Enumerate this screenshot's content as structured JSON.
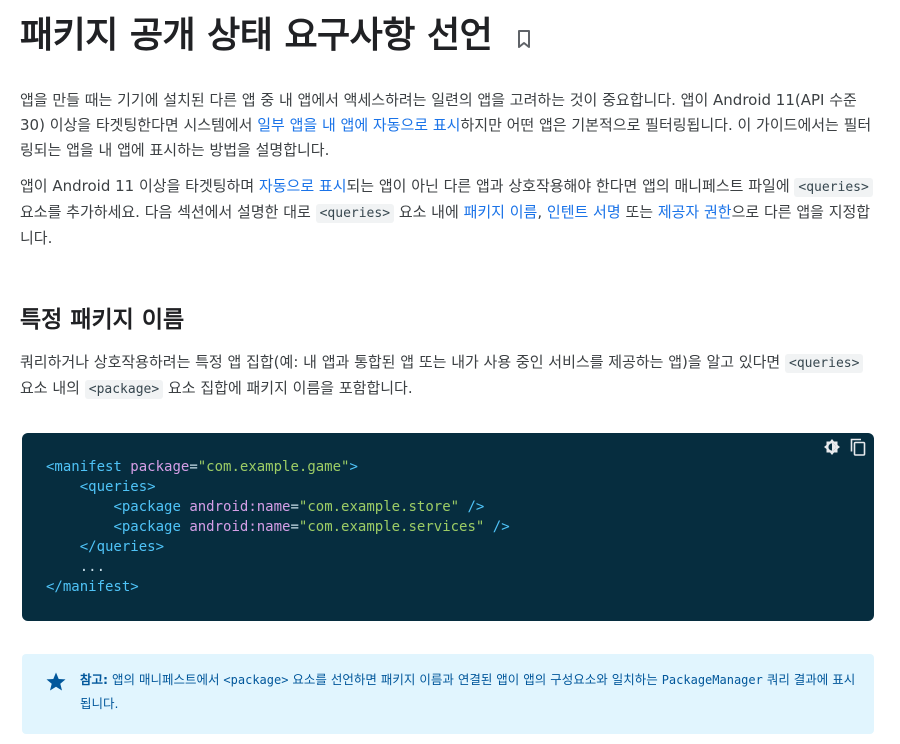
{
  "title": "패키지 공개 상태 요구사항 선언",
  "intro1": {
    "text_before": "앱을 만들 때는 기기에 설치된 다른 앱 중 내 앱에서 액세스하려는 일련의 앱을 고려하는 것이 중요합니다. 앱이 Android 11(API 수준 30) 이상을 타겟팅한다면 시스템에서 ",
    "link": "일부 앱을 내 앱에 자동으로 표시",
    "text_after": "하지만 어떤 앱은 기본적으로 필터링됩니다. 이 가이드에서는 필터링되는 앱을 내 앱에 표시하는 방법을 설명합니다."
  },
  "intro2": {
    "t1": "앱이 Android 11 이상을 타겟팅하며 ",
    "link1": "자동으로 표시",
    "t2": "되는 앱이 아닌 다른 앱과 상호작용해야 한다면 앱의 매니페스트 파일에 ",
    "code1": "<queries>",
    "t3": " 요소를 추가하세요. 다음 섹션에서 설명한 대로 ",
    "code2": "<queries>",
    "t4": " 요소 내에 ",
    "link2": "패키지 이름",
    "t5": ", ",
    "link3": "인텐트 서명",
    "t6": " 또는 ",
    "link4": "제공자 권한",
    "t7": "으로 다른 앱을 지정합니다."
  },
  "section": {
    "heading": "특정 패키지 이름",
    "t1": "쿼리하거나 상호작용하려는 특정 앱 집합(예: 내 앱과 통합된 앱 또는 내가 사용 중인 서비스를 제공하는 앱)을 알고 있다면 ",
    "code1": "<queries>",
    "t2": " 요소 내의 ",
    "code2": "<package>",
    "t3": " 요소 집합에 패키지 이름을 포함합니다."
  },
  "code": {
    "manifest_open": "<manifest",
    "attr_package": "package",
    "val_package": "\"com.example.game\"",
    "queries_open": "<queries>",
    "package_tag": "<package",
    "attr_name": "android:name",
    "val_store": "\"com.example.store\"",
    "val_services": "\"com.example.services\"",
    "self_close": " />",
    "queries_close": "</queries>",
    "ellipsis": "...",
    "manifest_close": "</manifest>",
    "gt": ">",
    "eq": "="
  },
  "note": {
    "label": "참고:",
    "t1": " 앱의 매니페스트에서 ",
    "code1": "<package>",
    "t2": " 요소를 선언하면 패키지 이름과 연결된 앱이 앱의 구성요소와 일치하는 ",
    "code2": "PackageManager",
    "t3": " 쿼리 결과에 표시됩니다."
  },
  "icons": {
    "bookmark": "bookmark-icon",
    "theme": "dark-mode-icon",
    "copy": "copy-icon",
    "note": "star-icon"
  },
  "colors": {
    "link": "#1a73e8",
    "code_bg": "#062d3f",
    "note_bg": "#e1f5fe",
    "note_text": "#01579b"
  }
}
